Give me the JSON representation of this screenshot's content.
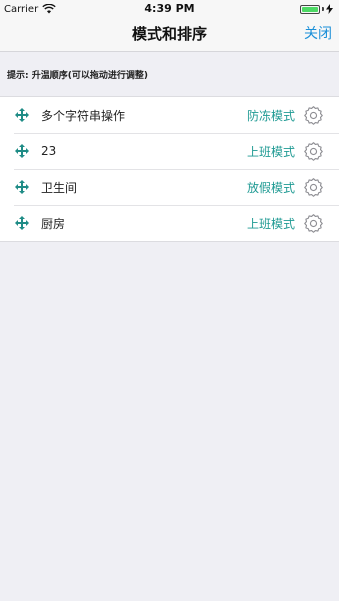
{
  "status_bar": {
    "carrier": "Carrier",
    "time": "4:39 PM"
  },
  "nav": {
    "title": "模式和排序",
    "close_label": "关闭"
  },
  "hint": "提示: 升温顺序(可以拖动进行调整)",
  "items": [
    {
      "name": "多个字符串操作",
      "mode": "防冻模式"
    },
    {
      "name": "23",
      "mode": "上班模式"
    },
    {
      "name": "卫生间",
      "mode": "放假模式"
    },
    {
      "name": "厨房",
      "mode": "上班模式"
    }
  ],
  "colors": {
    "accent": "#1a8fd8",
    "mode_text": "#1f9a93",
    "drag_icon": "#1f8c86",
    "gear_icon": "#8e8e93",
    "background": "#efeff4",
    "battery": "#4cd964"
  },
  "icons": {
    "drag": "move-arrows-icon",
    "settings": "gear-icon",
    "wifi": "wifi-icon",
    "battery": "battery-icon"
  }
}
